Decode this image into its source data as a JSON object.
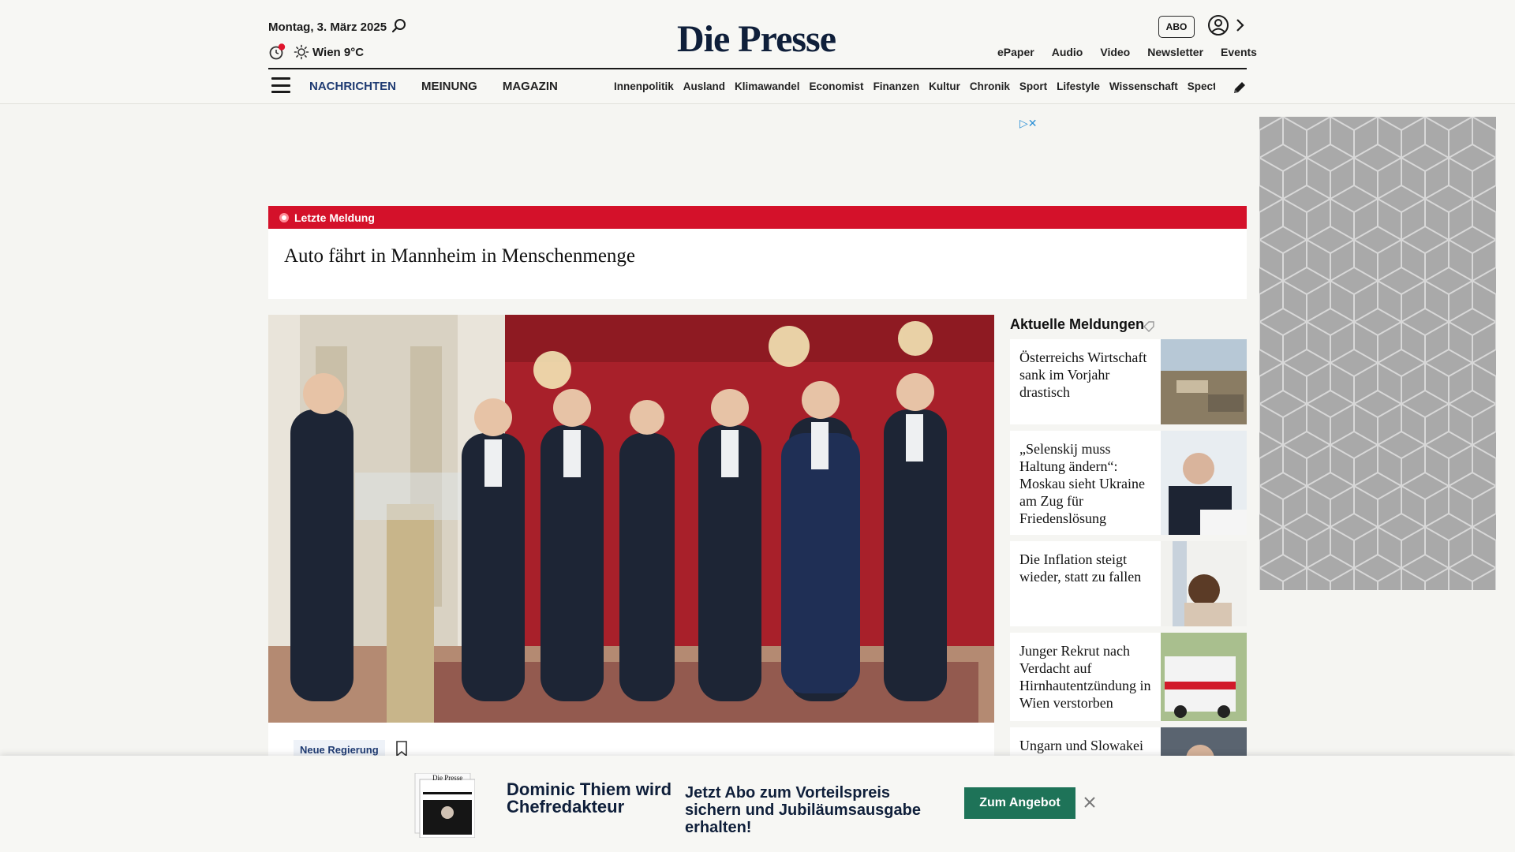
{
  "header": {
    "date": "Montag, 3. März 2025",
    "weather": "Wien 9°C",
    "logo": "Die Presse",
    "abo_label": "ABO",
    "top_links": [
      "ePaper",
      "Audio",
      "Video",
      "Newsletter",
      "Events"
    ],
    "nav_main": [
      "NACHRICHTEN",
      "MEINUNG",
      "MAGAZIN"
    ],
    "nav_sub": [
      "Innenpolitik",
      "Ausland",
      "Klimawandel",
      "Economist",
      "Finanzen",
      "Kultur",
      "Chronik",
      "Sport",
      "Lifestyle",
      "Wissenschaft",
      "Spectrum"
    ]
  },
  "breaking": {
    "label": "Letzte Meldung",
    "title": "Auto fährt in Mannheim in Menschenmenge"
  },
  "hero": {
    "tag": "Neue Regierung"
  },
  "aktuelle": {
    "title": "Aktuelle Meldungen",
    "items": [
      {
        "title": "Österreichs Wirtschaft sank im Vorjahr drastisch"
      },
      {
        "title": "„Selenskij muss Haltung ändern“: Moskau sieht Ukraine am Zug für Friedenslösung"
      },
      {
        "title": "Die Inflation steigt wieder, statt zu fallen"
      },
      {
        "title": "Junger Rekrut nach Verdacht auf Hirnhautentzündung in Wien verstorben"
      },
      {
        "title": "Ungarn und Slowakei"
      }
    ]
  },
  "banner": {
    "headline": "Dominic Thiem wird Chefredakteur",
    "text": "Jetzt Abo zum Vorteilspreis sichern und Jubiläumsausgabe erhalten!",
    "button": "Zum Angebot",
    "paper_label": "Die Presse"
  },
  "colors": {
    "brand_navy": "#0f1f3a",
    "breaking_red": "#d4112a",
    "cta_green": "#1e7358",
    "nav_blue": "#1f3b72"
  }
}
